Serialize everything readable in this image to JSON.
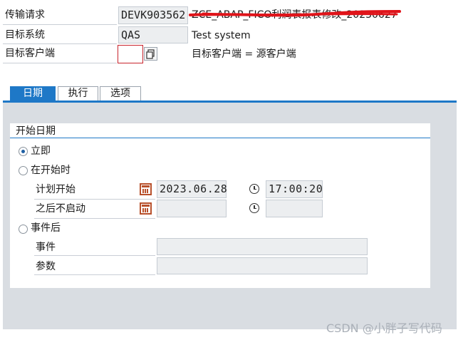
{
  "header": {
    "transport_label": "传输请求",
    "transport_value": "DEVK903562",
    "transport_desc": "ZCE_ABAP_FICO利润表报表修改_20230627",
    "target_system_label": "目标系统",
    "target_system_value": "QAS",
    "target_system_desc": "Test system",
    "target_client_label": "目标客户端",
    "target_client_value": "",
    "target_client_desc": "目标客户端 = 源客户端"
  },
  "tabs": [
    {
      "label": "日期",
      "active": true
    },
    {
      "label": "执行",
      "active": false
    },
    {
      "label": "选项",
      "active": false
    }
  ],
  "start_group": {
    "title": "开始日期",
    "immediate_label": "立即",
    "at_start_label": "在开始时",
    "planned_start_label": "计划开始",
    "planned_date": "2023.06.28",
    "planned_time": "17:00:20",
    "no_start_after_label": "之后不启动",
    "no_start_after_date": "",
    "no_start_after_time": "",
    "after_event_label": "事件后",
    "event_label": "事件",
    "event_value": "",
    "param_label": "参数",
    "param_value": "",
    "selected": "immediate"
  },
  "watermark": "CSDN @小胖子写代码",
  "colors": {
    "accent": "#1e78c7",
    "redline": "#e0141a"
  }
}
